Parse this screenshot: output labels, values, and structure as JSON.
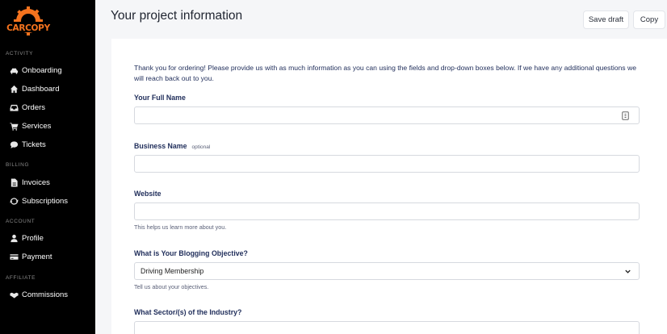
{
  "brand": {
    "name": "CARCOPY",
    "accent": "#f5731e"
  },
  "sidebar": {
    "sections": [
      {
        "title": "ACTIVITY",
        "items": [
          {
            "label": "Onboarding",
            "icon": "car-icon"
          },
          {
            "label": "Dashboard",
            "icon": "home-icon"
          },
          {
            "label": "Orders",
            "icon": "inbox-icon"
          },
          {
            "label": "Services",
            "icon": "cart-icon"
          },
          {
            "label": "Tickets",
            "icon": "chat-icon"
          }
        ]
      },
      {
        "title": "BILLING",
        "items": [
          {
            "label": "Invoices",
            "icon": "document-icon"
          },
          {
            "label": "Subscriptions",
            "icon": "refresh-icon"
          }
        ]
      },
      {
        "title": "ACCOUNT",
        "items": [
          {
            "label": "Profile",
            "icon": "user-icon"
          },
          {
            "label": "Payment",
            "icon": "credit-card-icon"
          }
        ]
      },
      {
        "title": "AFFILIATE",
        "items": [
          {
            "label": "Commissions",
            "icon": "handshake-icon"
          }
        ]
      }
    ]
  },
  "header": {
    "title": "Your project information",
    "save_label": "Save draft",
    "copy_label": "Copy"
  },
  "form": {
    "intro": "Thank you for ordering! Please provide us with as much information as you can using the fields and drop-down boxes below. If we have any additional questions we will reach back out to you.",
    "full_name": {
      "label": "Your Full Name",
      "value": ""
    },
    "business_name": {
      "label": "Business Name",
      "optional": "optional",
      "value": ""
    },
    "website": {
      "label": "Website",
      "value": "",
      "help": "This helps us learn more about you."
    },
    "blogging_objective": {
      "label": "What is Your Blogging Objective?",
      "value": "Driving Membership",
      "help": "Tell us about your objectives."
    },
    "sector": {
      "label": "What Sector/(s) of the Industry?",
      "value": ""
    }
  }
}
